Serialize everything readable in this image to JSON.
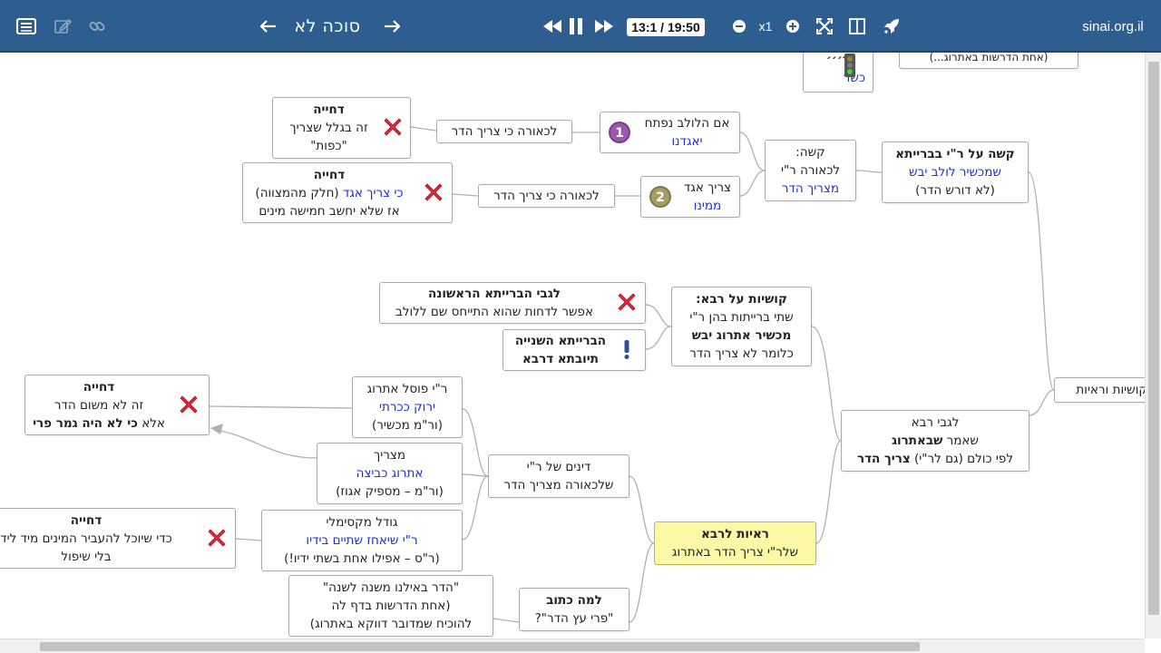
{
  "toolbar": {
    "title": "סוכה לא",
    "time": "13:1 / 19:50",
    "zoom": "x1",
    "site": "sinai.org.il"
  },
  "icons": {
    "menu": "list-icon",
    "edit": "pencil-icon",
    "link": "link-icon",
    "prev": "arrow-left-icon",
    "next": "arrow-right-icon",
    "rewind": "rewind-icon",
    "pause": "pause-icon",
    "forward": "fast-forward-icon",
    "zoom_out": "zoom-out-icon",
    "zoom_in": "zoom-in-icon",
    "fullscreen": "fullscreen-icon",
    "split": "split-view-icon",
    "launch": "rocket-icon"
  },
  "colors": {
    "toolbar": "#2e5e8f",
    "link_blue": "#1f2fd0",
    "highlight": "#fbf9a6",
    "reject_red": "#e0293b"
  },
  "nodes": {
    "kosher_top": {
      "l1": "ד׳׳׳",
      "l2": "כשר"
    },
    "kasha_reisha": {
      "l1": "קשה על ר\"י בברייתא",
      "l2": "שמכשיר לולב יבש",
      "l3": "(לא דורש הדר)"
    },
    "kasha": {
      "l1": "קשה:",
      "l2": "לכאורה ר\"י",
      "l3": "מצריך הדר"
    },
    "lulav_niftach": {
      "l1": "אם הלולב נפתח",
      "l2": "יאגדנו",
      "badge": "1"
    },
    "tzarich_eged": {
      "l1": "צריך אגד",
      "l2": "ממינו",
      "badge": "2"
    },
    "lechaora1": {
      "l1": "לכאורה כי צריך הדר"
    },
    "lechaora2": {
      "l1": "לכאורה כי צריך הדר"
    },
    "dechiya1": {
      "l1": "דחייה",
      "l2": "זה בגלל שצריך",
      "l3": "\"כפות\""
    },
    "dechiya2": {
      "l1": "דחייה",
      "l2a": "כי צריך אגד",
      "l2b": " (חלק מהמצווה)",
      "l3": "אז שלא יחשב חמישה מינים"
    },
    "kushiyot_rava": {
      "l1": "קושיות על רבא:",
      "l2": "שתי ברייתות בהן ר\"י",
      "l3": "מכשיר אתרוג יבש",
      "l4": "כלומר לא צריך הדר"
    },
    "braita_rishona": {
      "l1": "לגבי הברייתא הראשונה",
      "l2": "אפשר לדחות שהוא התייחס שם ללולב"
    },
    "braita_shniya": {
      "l1": "הברייתא השנייה",
      "l2": "תיובתא דרבא"
    },
    "kushiyot_reayot": {
      "l1": "קושיות וראיות"
    },
    "legabei_rava": {
      "l1": "לגבי רבא",
      "l2a": "שאמר ",
      "l2b": "שבאתרוג",
      "l3a": "לפי כולם (גם לר\"י) ",
      "l3b": "צריך הדר"
    },
    "rei_posel": {
      "l1": "ר\"י פוסל אתרוג",
      "l2": "ירוק ככרתי",
      "l3": "(ור\"מ מכשיר)"
    },
    "dechiya3": {
      "l1": "דחייה",
      "l2": "זה לא משום הדר",
      "l3a": "אלא ",
      "l3b": "כי לא היה גמר פרי"
    },
    "matzrich": {
      "l1": "מצריך",
      "l2": "אתרוג כביצה",
      "l3": "(ור\"מ – מספיק אגוז)"
    },
    "dinim": {
      "l1": "דינים של ר\"י",
      "l2": "שלכאורה מצריך הדר"
    },
    "godel": {
      "l1": "גודל מקסימלי",
      "l2": "ר\"י שיאחז שתיים בידיו",
      "l3": "(ר\"ס – אפילו אחת בשתי ידיו!)"
    },
    "dechiya4": {
      "l1": "דחייה",
      "l2": "כדי שיוכל להעביר המינים מיד ליד",
      "l3": "בלי שיפול"
    },
    "reayot": {
      "l1": "ראיות לרבא",
      "l2": "שלר\"י צריך הדר באתרוג"
    },
    "hadar": {
      "l1": "\"הדר באילנו משנה לשנה\"",
      "l2": "(אחת הדרשות בדף לה",
      "l3": "להוכיח שמדובר דווקא באתרוג)"
    },
    "lama_katuv": {
      "l1": "למה כתוב",
      "l2": "\"פרי עץ הדר\"?"
    },
    "top_right_stub": {
      "l1": "(אחת הדרשות באתרוג...)"
    }
  }
}
